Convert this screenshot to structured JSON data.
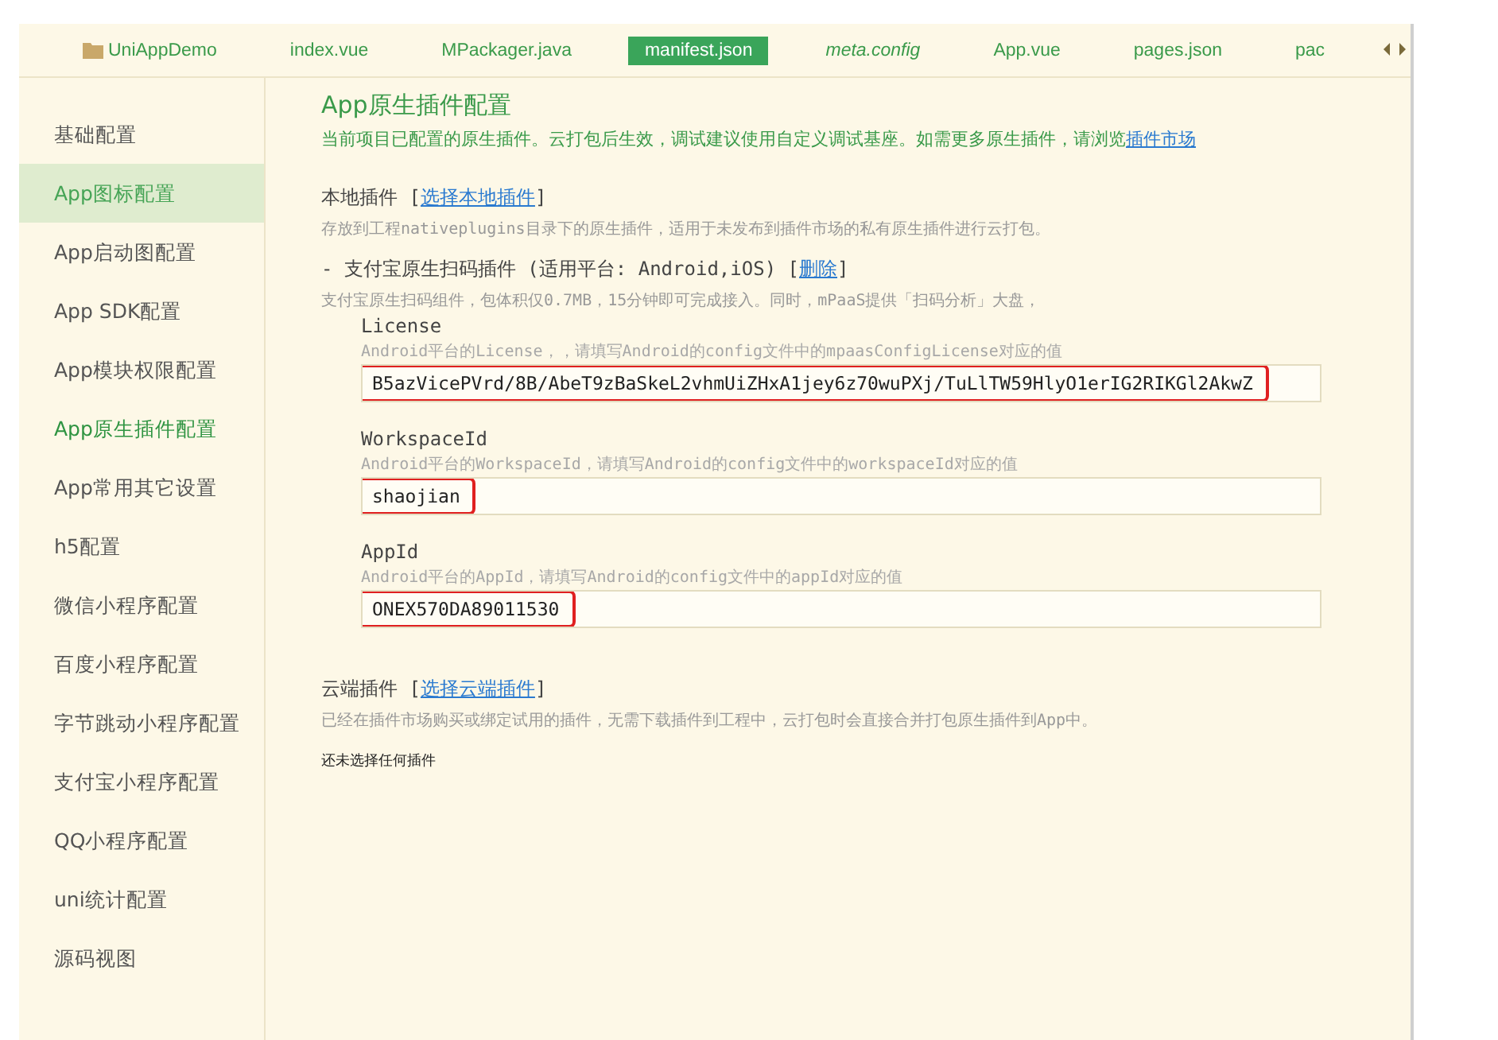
{
  "tabs": [
    {
      "label": "UniAppDemo",
      "kind": "folder",
      "selected": false,
      "italic": false
    },
    {
      "label": "index.vue",
      "kind": "file",
      "selected": false,
      "italic": false
    },
    {
      "label": "MPackager.java",
      "kind": "file",
      "selected": false,
      "italic": false
    },
    {
      "label": "manifest.json",
      "kind": "file",
      "selected": true,
      "italic": false
    },
    {
      "label": "meta.config",
      "kind": "file",
      "selected": false,
      "italic": true
    },
    {
      "label": "App.vue",
      "kind": "file",
      "selected": false,
      "italic": false
    },
    {
      "label": "pages.json",
      "kind": "file",
      "selected": false,
      "italic": false
    },
    {
      "label": "pac",
      "kind": "file",
      "selected": false,
      "italic": false
    }
  ],
  "sidebar": {
    "items": [
      {
        "label": "基础配置",
        "hovered": false,
        "selected": false
      },
      {
        "label": "App图标配置",
        "hovered": true,
        "selected": false
      },
      {
        "label": "App启动图配置",
        "hovered": false,
        "selected": false
      },
      {
        "label": "App SDK配置",
        "hovered": false,
        "selected": false
      },
      {
        "label": "App模块权限配置",
        "hovered": false,
        "selected": false
      },
      {
        "label": "App原生插件配置",
        "hovered": false,
        "selected": true
      },
      {
        "label": "App常用其它设置",
        "hovered": false,
        "selected": false
      },
      {
        "label": "h5配置",
        "hovered": false,
        "selected": false
      },
      {
        "label": "微信小程序配置",
        "hovered": false,
        "selected": false
      },
      {
        "label": "百度小程序配置",
        "hovered": false,
        "selected": false
      },
      {
        "label": "字节跳动小程序配置",
        "hovered": false,
        "selected": false
      },
      {
        "label": "支付宝小程序配置",
        "hovered": false,
        "selected": false
      },
      {
        "label": "QQ小程序配置",
        "hovered": false,
        "selected": false
      },
      {
        "label": "uni统计配置",
        "hovered": false,
        "selected": false
      },
      {
        "label": "源码视图",
        "hovered": false,
        "selected": false
      }
    ]
  },
  "page": {
    "title": "App原生插件配置",
    "intro": "当前项目已配置的原生插件。云打包后生效，调试建议使用自定义调试基座。如需更多原生插件，请浏览",
    "intro_link": "插件市场",
    "local": {
      "heading": "本地插件",
      "open": "[",
      "link": "选择本地插件",
      "close": "]",
      "description": "存放到工程nativeplugins目录下的原生插件，适用于未发布到插件市场的私有原生插件进行云打包。",
      "plugin": {
        "name": "- 支付宝原生扫码插件 (适用平台: Android,iOS)",
        "open": "[",
        "remove": "删除",
        "close": "]",
        "description": "支付宝原生扫码组件，包体积仅0.7MB，15分钟即可完成接入。同时，mPaaS提供「扫码分析」大盘，",
        "fields": [
          {
            "label": "License",
            "hint": "Android平台的License，，请填写Android的config文件中的mpaasConfigLicense对应的值",
            "value": "B5azVicePVrd/8B/AbeT9zBaSkeL2vhmUiZHxA1jey6z70wuPXj/TuLlTW59HlyO1erIG2RIKGl2AkwZ",
            "highlighted": true
          },
          {
            "label": "WorkspaceId",
            "hint": "Android平台的WorkspaceId，请填写Android的config文件中的workspaceId对应的值",
            "value": "shaojian",
            "highlighted": true
          },
          {
            "label": "AppId",
            "hint": "Android平台的AppId，请填写Android的config文件中的appId对应的值",
            "value": "ONEX570DA89011530",
            "highlighted": true
          }
        ]
      }
    },
    "cloud": {
      "heading": "云端插件",
      "open": "[",
      "link": "选择云端插件",
      "close": "]",
      "description": "已经在插件市场购买或绑定试用的插件，无需下载插件到工程中，云打包时会直接合并打包原生插件到App中。",
      "empty": "还未选择任何插件"
    }
  }
}
